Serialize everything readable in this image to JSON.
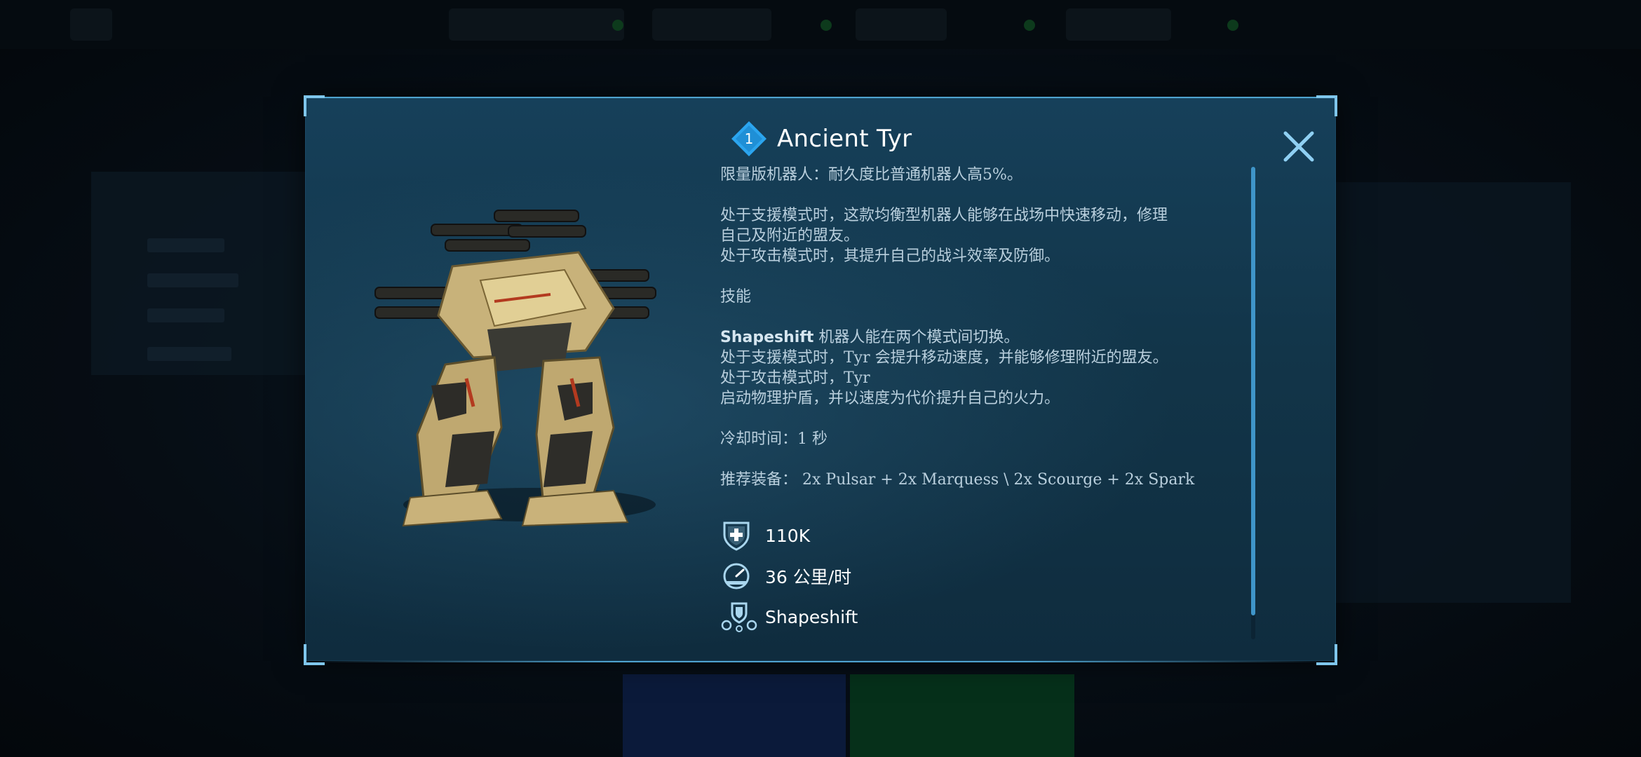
{
  "dialog": {
    "tier": "1",
    "title": "Ancient Tyr",
    "close_icon": "close-icon",
    "description": {
      "line1": "限量版机器人：耐久度比普通机器人高5%。",
      "line2": "处于支援模式时，这款均衡型机器人能够在战场中快速移动，修理",
      "line3": "自己及附近的盟友。",
      "line4": "处于攻击模式时，其提升自己的战斗效率及防御。",
      "ability_header": "技能",
      "ability_name": "Shapeshift",
      "ability_line1": " 机器人能在两个模式间切换。",
      "ability_line2": "处于支援模式时，Tyr 会提升移动速度，并能够修理附近的盟友。",
      "ability_line3": "处于攻击模式时，Tyr",
      "ability_line4": "启动物理护盾，并以速度为代价提升自己的火力。",
      "cooldown": "冷却时间：1 秒",
      "loadout": "推荐装备： 2x Pulsar + 2x Marquess \\ 2x Scourge + 2x Spark"
    },
    "stats": {
      "durability": {
        "icon": "shield-plus-icon",
        "value": "110K"
      },
      "speed": {
        "icon": "speedometer-icon",
        "value": "36 公里/时"
      },
      "ability": {
        "icon": "shapeshift-icon",
        "value": "Shapeshift"
      }
    },
    "colors": {
      "accent": "#3f95c9",
      "badge": "#2b9ee6",
      "frame": "#7fc6ec"
    }
  }
}
